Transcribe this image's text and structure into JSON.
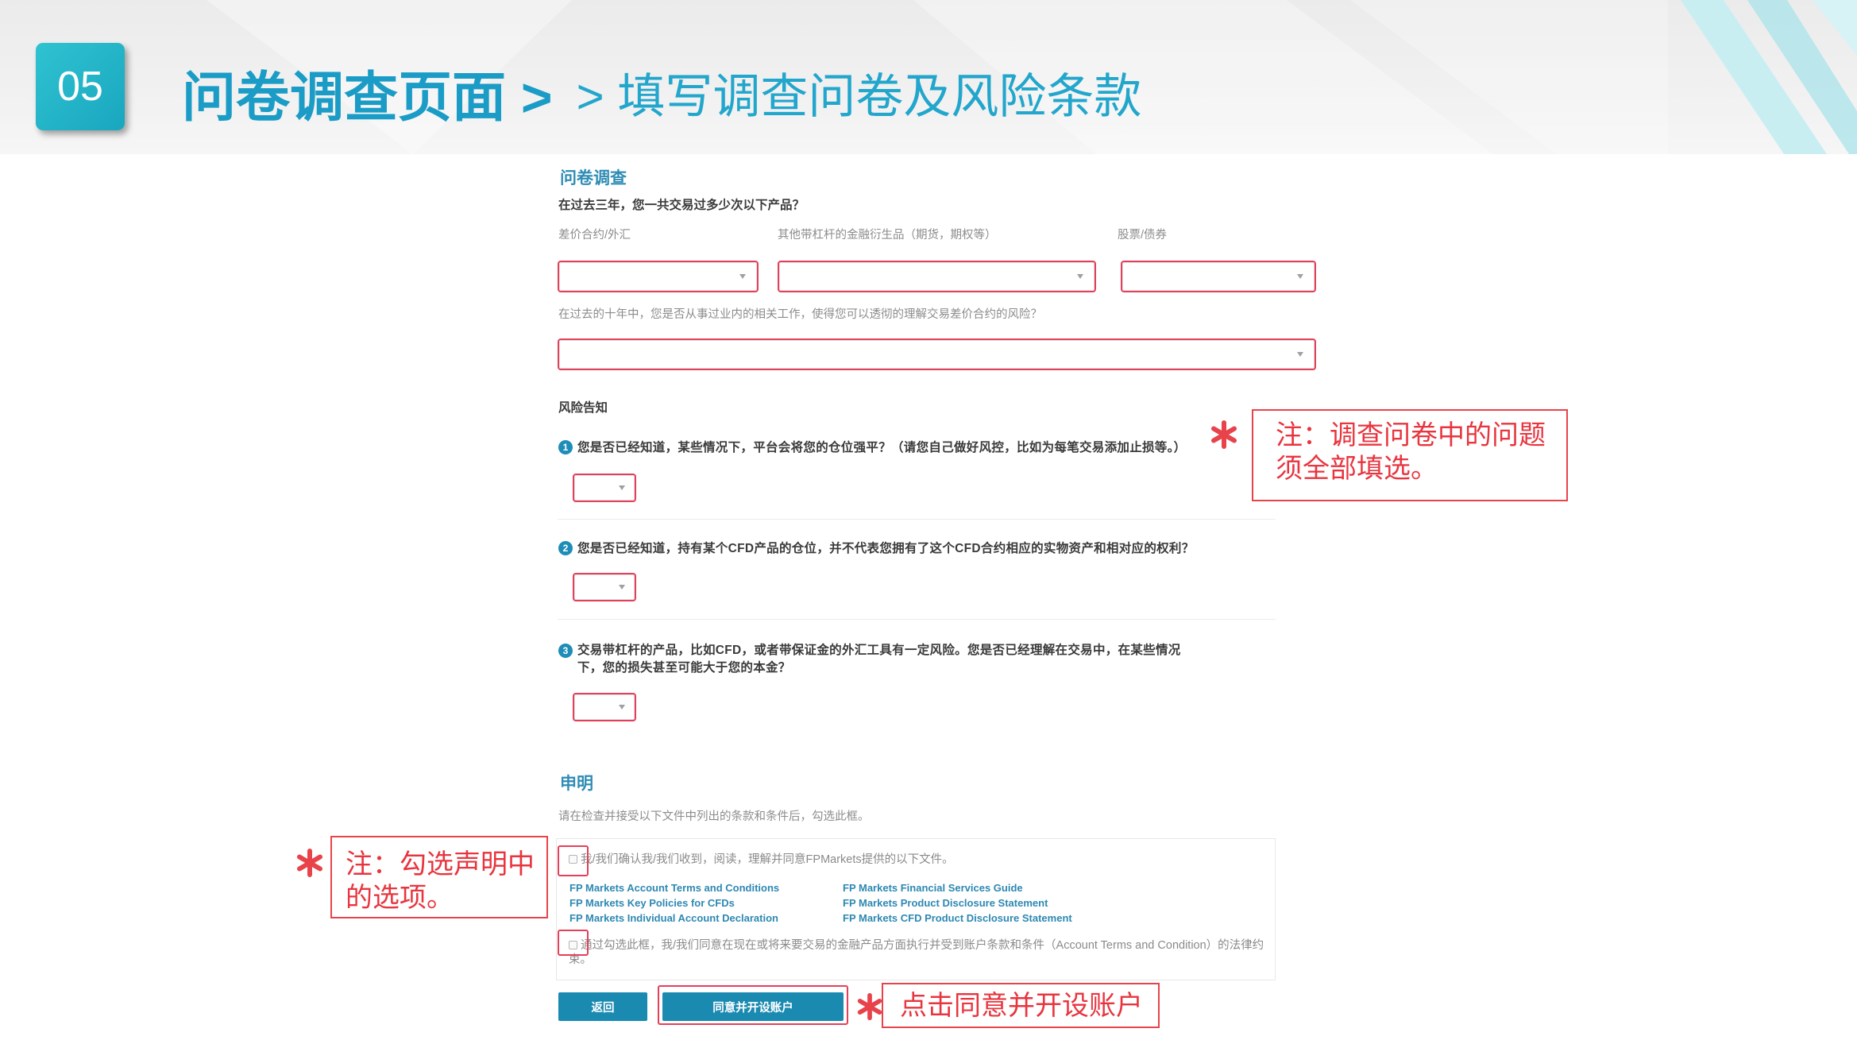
{
  "header": {
    "badge": "05",
    "title_main": "问卷调查页面 >",
    "title_sub": "> 填写调查问卷及风险条款"
  },
  "survey": {
    "heading": "问卷调查",
    "q_trades": "在过去三年，您一共交易过多少次以下产品？",
    "trade_fields": [
      {
        "label": "差价合约/外汇",
        "value": ""
      },
      {
        "label": "其他带杠杆的金融衍生品（期货，期权等）",
        "value": ""
      },
      {
        "label": "股票/债券",
        "value": ""
      }
    ],
    "q_experience": "在过去的十年中，您是否从事过业内的相关工作，使得您可以透彻的理解交易差价合约的风险？",
    "experience_value": ""
  },
  "risk": {
    "heading": "风险告知",
    "questions": [
      {
        "num": "1",
        "text": "您是否已经知道，某些情况下，平台会将您的仓位强平？（请您自己做好风控，比如为每笔交易添加止损等。）",
        "value": ""
      },
      {
        "num": "2",
        "text": "您是否已经知道，持有某个CFD产品的仓位，并不代表您拥有了这个CFD合约相应的实物资产和相对应的权利？",
        "value": ""
      },
      {
        "num": "3",
        "text": "交易带杠杆的产品，比如CFD，或者带保证金的外汇工具有一定风险。您是否已经理解在交易中，在某些情况下，您的损失甚至可能大于您的本金？",
        "value": ""
      }
    ]
  },
  "declaration": {
    "heading": "申明",
    "instruction": "请在检查并接受以下文件中列出的条款和条件后，勾选此框。",
    "confirm_text": "我/我们确认我/我们收到，阅读，理解并同意FPMarkets提供的以下文件。",
    "confirm_checked": false,
    "documents_left": [
      "FP Markets Account Terms and Conditions",
      "FP Markets Key Policies for CFDs",
      "FP Markets Individual Account Declaration"
    ],
    "documents_right": [
      "FP Markets Financial Services Guide",
      "FP Markets Product Disclosure Statement",
      "FP Markets CFD Product Disclosure Statement"
    ],
    "agree_text": "通过勾选此框，我/我们同意在现在或将来要交易的金融产品方面执行并受到账户条款和条件（Account Terms and Condition）的法律约束。",
    "agree_checked": false
  },
  "actions": {
    "back": "返回",
    "submit": "同意并开设账户"
  },
  "annotations": {
    "survey_note": "注：调查问卷中的问题须全部填选。",
    "declaration_note": "注：勾选声明中的选项。",
    "submit_note": "点击同意并开设账户",
    "marker_icon": "asterisk-icon"
  },
  "icons": {
    "dropdown": "chevron-down-icon"
  },
  "colors": {
    "title": "#1a9cc6",
    "badge": "#19a6bf",
    "form_accent": "#2f8cb4",
    "button": "#1a8ab1",
    "highlight_red": "#e4405a",
    "annotation_red": "#e8353f"
  }
}
